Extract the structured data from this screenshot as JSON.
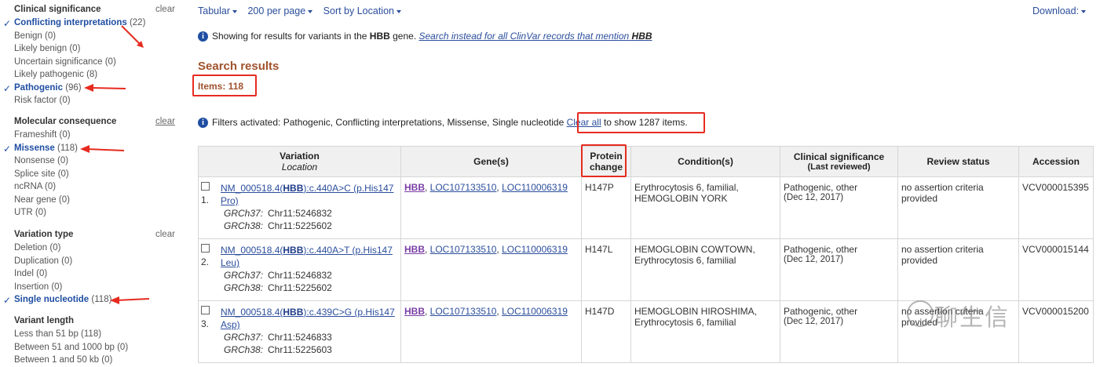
{
  "sidebar": {
    "clinical": {
      "title": "Clinical significance",
      "clear": "clear",
      "items": [
        {
          "label": "Conflicting interpretations",
          "count": "(22)",
          "selected": true
        },
        {
          "label": "Benign",
          "count": "(0)",
          "selected": false
        },
        {
          "label": "Likely benign",
          "count": "(0)",
          "selected": false
        },
        {
          "label": "Uncertain significance",
          "count": "(0)",
          "selected": false
        },
        {
          "label": "Likely pathogenic",
          "count": "(8)",
          "selected": false
        },
        {
          "label": "Pathogenic",
          "count": "(96)",
          "selected": true
        },
        {
          "label": "Risk factor",
          "count": "(0)",
          "selected": false
        }
      ]
    },
    "molecular": {
      "title": "Molecular consequence",
      "clear": "clear",
      "items": [
        {
          "label": "Frameshift",
          "count": "(0)",
          "selected": false
        },
        {
          "label": "Missense",
          "count": "(118)",
          "selected": true
        },
        {
          "label": "Nonsense",
          "count": "(0)",
          "selected": false
        },
        {
          "label": "Splice site",
          "count": "(0)",
          "selected": false
        },
        {
          "label": "ncRNA",
          "count": "(0)",
          "selected": false
        },
        {
          "label": "Near gene",
          "count": "(0)",
          "selected": false
        },
        {
          "label": "UTR",
          "count": "(0)",
          "selected": false
        }
      ]
    },
    "variation_type": {
      "title": "Variation type",
      "clear": "clear",
      "items": [
        {
          "label": "Deletion",
          "count": "(0)",
          "selected": false
        },
        {
          "label": "Duplication",
          "count": "(0)",
          "selected": false
        },
        {
          "label": "Indel",
          "count": "(0)",
          "selected": false
        },
        {
          "label": "Insertion",
          "count": "(0)",
          "selected": false
        },
        {
          "label": "Single nucleotide",
          "count": "(118)",
          "selected": true
        }
      ]
    },
    "variant_length": {
      "title": "Variant length",
      "items": [
        {
          "label": "Less than 51 bp",
          "count": "(118)",
          "selected": false
        },
        {
          "label": "Between 51 and 1000 bp",
          "count": "(0)",
          "selected": false
        },
        {
          "label": "Between 1 and 50 kb",
          "count": "(0)",
          "selected": false
        }
      ]
    }
  },
  "toolbar": {
    "format": "Tabular",
    "per_page": "200 per page",
    "sort": "Sort by Location",
    "download": "Download:"
  },
  "notice1": {
    "prefix": "Showing for results for variants in the",
    "gene": "HBB",
    "suffix": "gene.",
    "link_prefix": "Search instead for all ClinVar records that mention",
    "link_gene": "HBB"
  },
  "results": {
    "title": "Search results",
    "items": "Items: 118"
  },
  "notice2": {
    "text": "Filters activated: Pathogenic, Conflicting interpretations, Missense, Single nucleotide",
    "clear_all": "Clear all",
    "suffix": "to show 1287 items."
  },
  "table": {
    "headers": {
      "variation": "Variation",
      "location": "Location",
      "genes": "Gene(s)",
      "protein_line1": "Protein",
      "protein_line2": "change",
      "conditions": "Condition(s)",
      "clinsig": "Clinical significance",
      "last_reviewed": "(Last reviewed)",
      "review": "Review status",
      "accession": "Accession"
    },
    "rows": [
      {
        "num": "1.",
        "var_pre": "NM_000518.4(",
        "var_gene": "HBB",
        "var_post": "):c.440A>C (p.His147Pro)",
        "grch37_label": "GRCh37:",
        "grch37": "Chr11:5246832",
        "grch38_label": "GRCh38:",
        "grch38": "Chr11:5225602",
        "gene_main": "HBB",
        "gene2": "LOC107133510",
        "gene3": "LOC110006319",
        "protein": "H147P",
        "condition": "Erythrocytosis 6, familial, HEMOGLOBIN YORK",
        "clinsig": "Pathogenic, other",
        "date": "(Dec 12, 2017)",
        "review": "no assertion criteria provided",
        "accession": "VCV000015395"
      },
      {
        "num": "2.",
        "var_pre": "NM_000518.4(",
        "var_gene": "HBB",
        "var_post": "):c.440A>T (p.His147Leu)",
        "grch37_label": "GRCh37:",
        "grch37": "Chr11:5246832",
        "grch38_label": "GRCh38:",
        "grch38": "Chr11:5225602",
        "gene_main": "HBB",
        "gene2": "LOC107133510",
        "gene3": "LOC110006319",
        "protein": "H147L",
        "condition": "HEMOGLOBIN COWTOWN, Erythrocytosis 6, familial",
        "clinsig": "Pathogenic, other",
        "date": "(Dec 12, 2017)",
        "review": "no assertion criteria provided",
        "accession": "VCV000015144"
      },
      {
        "num": "3.",
        "var_pre": "NM_000518.4(",
        "var_gene": "HBB",
        "var_post": "):c.439C>G (p.His147Asp)",
        "grch37_label": "GRCh37:",
        "grch37": "Chr11:5246833",
        "grch38_label": "GRCh38:",
        "grch38": "Chr11:5225603",
        "gene_main": "HBB",
        "gene2": "LOC107133510",
        "gene3": "LOC110006319",
        "protein": "H147D",
        "condition": "HEMOGLOBIN HIROSHIMA, Erythrocytosis 6, familial",
        "clinsig": "Pathogenic, other",
        "date": "(Dec 12, 2017)",
        "review": "no assertion criteria provided",
        "accession": "VCV000015200"
      }
    ]
  },
  "watermark": "聊生信",
  "colors": {
    "annotation": "#e62b20",
    "link": "#2b4e9c",
    "result_title": "#a0522d"
  }
}
